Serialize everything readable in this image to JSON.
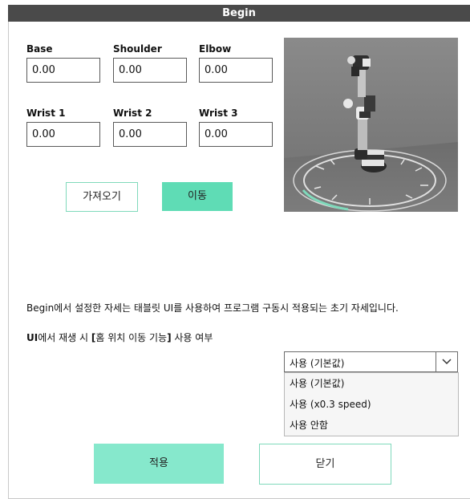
{
  "window": {
    "title": "Begin"
  },
  "joints": [
    {
      "label": "Base",
      "value": "0.00"
    },
    {
      "label": "Shoulder",
      "value": "0.00"
    },
    {
      "label": "Elbow",
      "value": "0.00"
    },
    {
      "label": "Wrist 1",
      "value": "0.00"
    },
    {
      "label": "Wrist 2",
      "value": "0.00"
    },
    {
      "label": "Wrist 3",
      "value": "0.00"
    }
  ],
  "actions": {
    "fetch_label": "가져오기",
    "move_label": "이동"
  },
  "description": {
    "line1": "Begin에서 설정한 자세는 태블릿 UI를 사용하여 프로그램 구동시 적용되는 초기 자세입니다.",
    "line2_prefix": "UI",
    "line2_rest": "에서 재생 시 ",
    "line2_bracket_open": "[",
    "line2_feature": "홈 위치 이동 기능",
    "line2_bracket_close": "]",
    "line2_suffix": " 사용 여부"
  },
  "home_move": {
    "selected": "사용 (기본값)",
    "options": [
      "사용 (기본값)",
      "사용 (x0.3 speed)",
      "사용 안함"
    ]
  },
  "footer": {
    "apply_label": "적용",
    "close_label": "닫기"
  },
  "colors": {
    "titlebar": "#4a4a4a",
    "accent_fill": "#5fdcb5",
    "accent_border": "#7fd9bb",
    "viewport_bg": "#6e6e6e"
  },
  "icons": {
    "select_arrow": "chevron-down-icon"
  }
}
